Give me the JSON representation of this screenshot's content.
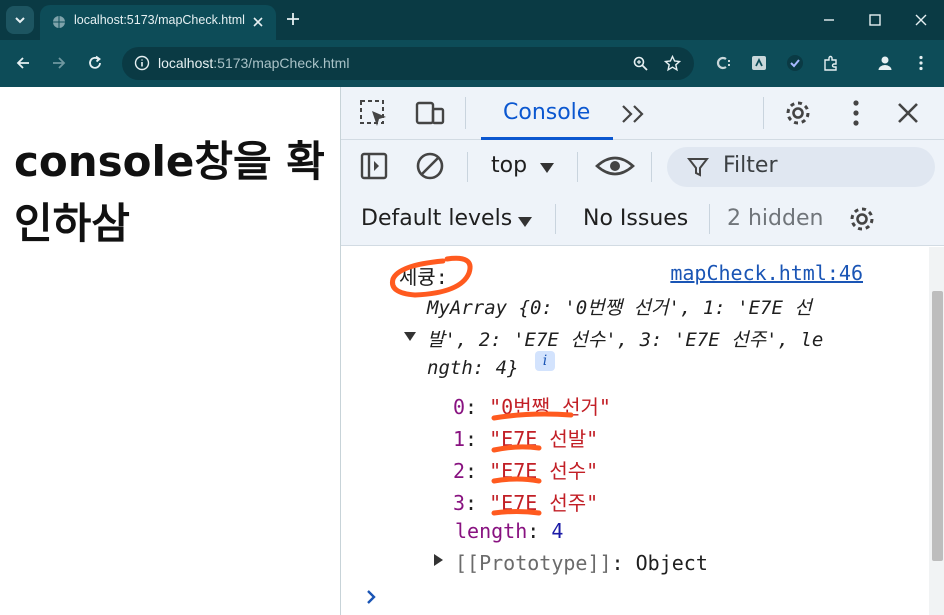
{
  "browser": {
    "tab_title": "localhost:5173/mapCheck.html",
    "url_host": "localhost",
    "url_rest": ":5173/mapCheck.html"
  },
  "page": {
    "heading": "console창을 확인하삼"
  },
  "devtools": {
    "active_tab": "Console",
    "context": "top",
    "filter_placeholder": "Filter",
    "levels": "Default levels",
    "issues": "No Issues",
    "hidden": "2 hidden"
  },
  "console": {
    "log_label": "세큥:",
    "source_link": "mapCheck.html:46",
    "preview_lines": [
      "MyArray {0: '0번쨍 선거', 1: 'E7E 선",
      "발', 2: 'E7E 선수', 3: 'E7E 선주', le",
      "ngth: 4}"
    ],
    "info_badge": "i",
    "properties": [
      {
        "key": "0",
        "value": "\"0번쨍 선거\""
      },
      {
        "key": "1",
        "value": "\"E7E 선발\""
      },
      {
        "key": "2",
        "value": "\"E7E 선수\""
      },
      {
        "key": "3",
        "value": "\"E7E 선주\""
      }
    ],
    "length_key": "length",
    "length_value": "4",
    "prototype_label": "[[Prototype]]",
    "prototype_value": "Object"
  },
  "colors": {
    "chrome_dark": "#0a3a44",
    "chrome_toolbar": "#0d4c58",
    "devtools_accent": "#0b57d0",
    "highlight_marker": "#ff5a1f"
  },
  "icons": {
    "tab_search": "chevron-down-icon",
    "favicon": "globe-icon",
    "tab_close": "close-icon",
    "new_tab": "plus-icon",
    "back": "arrow-left-icon",
    "forward": "arrow-right-icon",
    "reload": "reload-icon",
    "site_info": "info-icon",
    "zoom": "zoom-icon",
    "bookmark": "star-icon",
    "menu": "more-vert-icon"
  }
}
